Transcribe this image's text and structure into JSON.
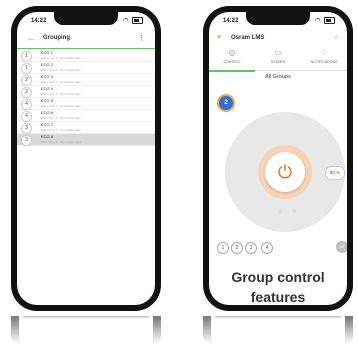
{
  "left_phone": {
    "status_time": "14:22",
    "status_icons": "ᯤ",
    "back_icon": "arrow-left-icon",
    "title": "Grouping",
    "menu_icon": "more-vertical-icon",
    "rows": [
      {
        "num": "1",
        "name": "ECG 1",
        "sub": "Ekko Type 4 · Dimmable Light"
      },
      {
        "num": "1",
        "name": "ECG 2",
        "sub": "Ekko Type 4 · Dimmable Light"
      },
      {
        "num": "2",
        "name": "ECG 3",
        "sub": "Ekko Type 4 · Dimmable Light"
      },
      {
        "num": "2",
        "name": "ECG 4",
        "sub": "Ekko Type 4 · Dimmable Light"
      },
      {
        "num": "4",
        "name": "ECG 5",
        "sub": "Ekko Type 4 · Dimmable Light"
      },
      {
        "num": "4",
        "name": "ECG 6",
        "sub": "Ekko Type 4 · Dimmable Light"
      },
      {
        "num": "3",
        "name": "ECG 7",
        "sub": "Ekko Type 4 · Dimmable Light"
      },
      {
        "num": "3",
        "name": "ECG 8",
        "sub": "Ekko Type 4 · Dimmable Light",
        "selected": true
      }
    ]
  },
  "right_phone": {
    "status_time": "14:22",
    "status_icons": "ᯤ",
    "title": "Osram LMS",
    "tabs": [
      {
        "label": "CONTROL",
        "icon": "bulb-icon",
        "active": true
      },
      {
        "label": "SCENES",
        "icon": "monitor-icon",
        "active": false
      },
      {
        "label": "NOTIFICATIONS",
        "icon": "bell-icon",
        "active": false
      }
    ],
    "group_title": "All Groups",
    "badge": "2",
    "level_percent": "80 %",
    "level_value": 0.8,
    "group_buttons": [
      "1",
      "2",
      "3",
      "4"
    ],
    "all_label": "All",
    "caption_line1": "Group control",
    "caption_line2": "features"
  },
  "colors": {
    "accent": "#f26b21",
    "green": "#5dc66d",
    "badge_blue": "#2f6fd6"
  }
}
